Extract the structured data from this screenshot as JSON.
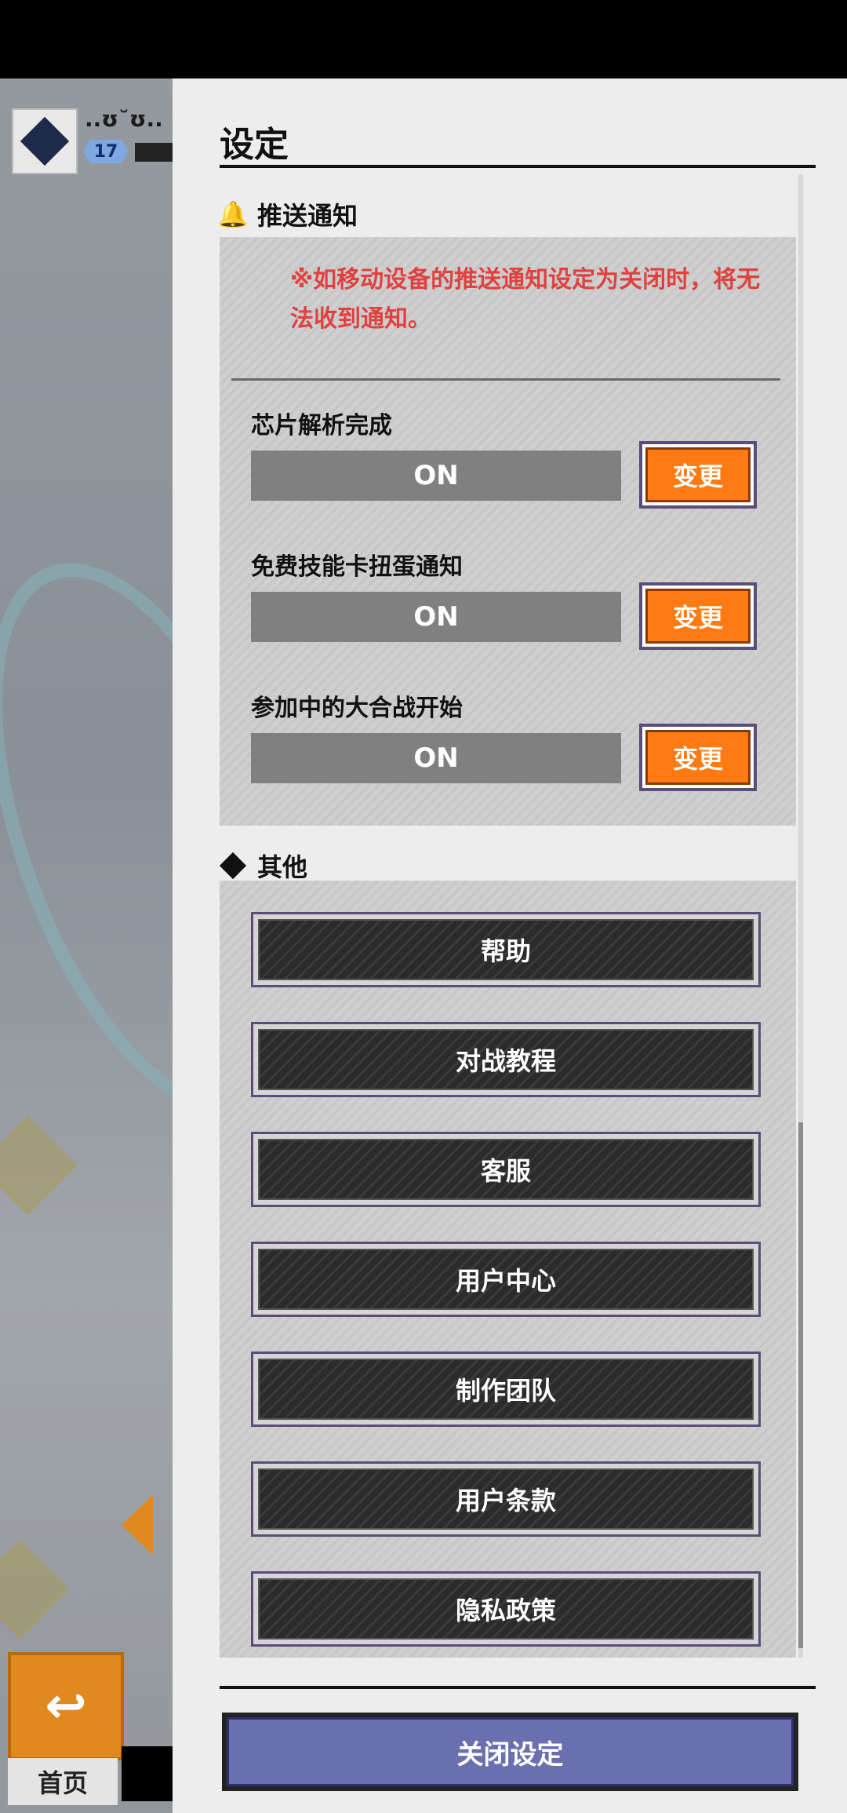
{
  "background": {
    "player_name": "..ʊ˘ʊ..",
    "player_level": "17",
    "home_label": "首页"
  },
  "panel": {
    "title": "设定",
    "push_section": {
      "title": "推送通知",
      "icon": "bell-icon",
      "warning": "※如移动设备的推送通知设定为关闭时，将无法收到通知。",
      "items": [
        {
          "label": "芯片解析完成",
          "state": "ON",
          "button": "变更"
        },
        {
          "label": "免费技能卡扭蛋通知",
          "state": "ON",
          "button": "变更"
        },
        {
          "label": "参加中的大合战开始",
          "state": "ON",
          "button": "变更"
        }
      ]
    },
    "other_section": {
      "title": "其他",
      "icon": "diamond-logo-icon",
      "buttons": [
        "帮助",
        "对战教程",
        "客服",
        "用户中心",
        "制作团队",
        "用户条款",
        "隐私政策"
      ]
    },
    "close_button": "关闭设定"
  },
  "colors": {
    "accent_orange": "#ff7a12",
    "warning_red": "#e0413f",
    "close_blue": "#6a6fb0"
  }
}
